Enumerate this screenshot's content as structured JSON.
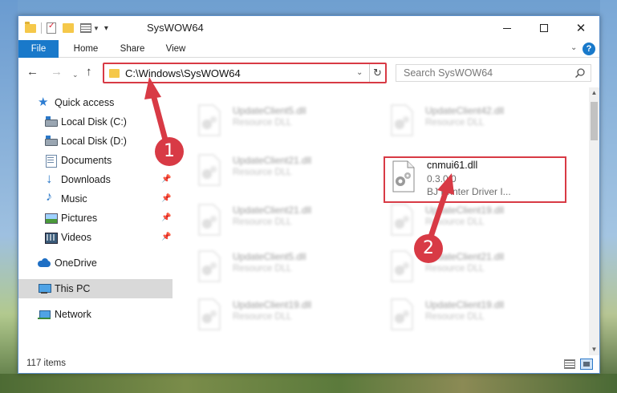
{
  "window": {
    "title": "SysWOW64"
  },
  "ribbon": {
    "tabs": [
      "File",
      "Home",
      "Share",
      "View"
    ],
    "help": "?"
  },
  "address": {
    "path": "C:\\Windows\\SysWOW64",
    "search_placeholder": "Search SysWOW64"
  },
  "nav": {
    "items": [
      {
        "label": "Quick access",
        "icon": "star-icon"
      },
      {
        "label": "Local Disk (C:)",
        "icon": "disk-icon"
      },
      {
        "label": "Local Disk (D:)",
        "icon": "disk-icon"
      },
      {
        "label": "Documents",
        "icon": "documents-icon"
      },
      {
        "label": "Downloads",
        "icon": "download-icon",
        "pinned": true
      },
      {
        "label": "Music",
        "icon": "music-icon",
        "pinned": true
      },
      {
        "label": "Pictures",
        "icon": "pictures-icon",
        "pinned": true
      },
      {
        "label": "Videos",
        "icon": "videos-icon",
        "pinned": true
      },
      {
        "label": "OneDrive",
        "icon": "cloud-icon"
      },
      {
        "label": "This PC",
        "icon": "pc-icon",
        "selected": true
      },
      {
        "label": "Network",
        "icon": "network-icon"
      }
    ]
  },
  "files": {
    "blurred": [
      {
        "name": "UpdateClient5.dll",
        "desc": "Resource DLL"
      },
      {
        "name": "UpdateClient42.dll",
        "desc": "Resource DLL"
      },
      {
        "name": "UpdateClient21.dll",
        "desc": "Resource DLL"
      },
      {
        "name": "UpdateClient21.dll",
        "desc": "Resource DLL"
      },
      {
        "name": "UpdateClient19.dll",
        "desc": "Resource DLL"
      },
      {
        "name": "UpdateClient5.dll",
        "desc": "Resource DLL"
      },
      {
        "name": "UpdateClient21.dll",
        "desc": "Resource DLL"
      },
      {
        "name": "UpdateClient19.dll",
        "desc": "Resource DLL"
      },
      {
        "name": "UpdateClient19.dll",
        "desc": "Resource DLL"
      }
    ],
    "highlighted": {
      "name": "cnmui61.dll",
      "version": "0.3.0.0",
      "desc": "BJ Printer Driver I..."
    }
  },
  "status": {
    "item_count": "117 items"
  },
  "annotations": {
    "step1": "1",
    "step2": "2",
    "color": "#d83a45"
  },
  "colors": {
    "accent": "#1979ca",
    "highlight": "#d83a45"
  }
}
